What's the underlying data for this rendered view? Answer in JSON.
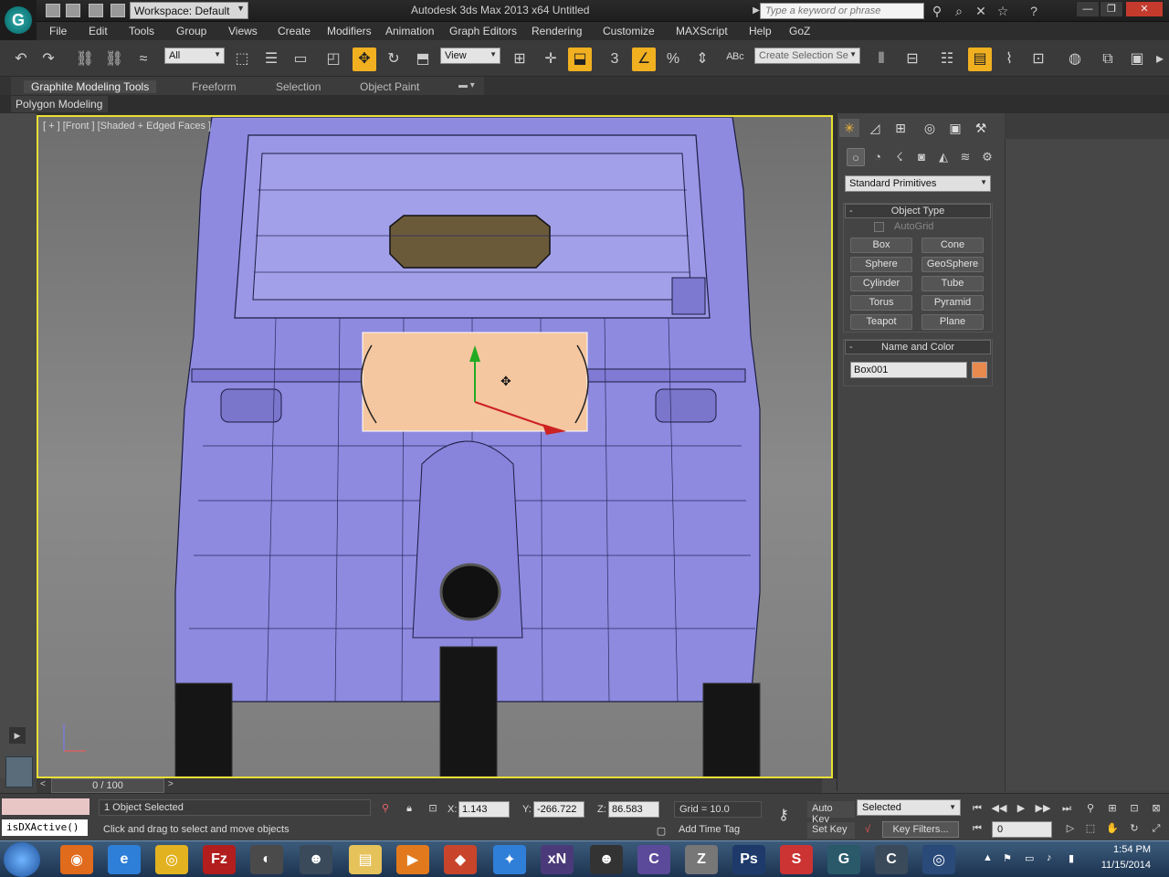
{
  "titlebar": {
    "workspace": "Workspace: Default",
    "title": "Autodesk 3ds Max  2013 x64      Untitled",
    "search_placeholder": "Type a keyword or phrase"
  },
  "menu": [
    "File",
    "Edit",
    "Tools",
    "Group",
    "Views",
    "Create",
    "Modifiers",
    "Animation",
    "Graph Editors",
    "Rendering",
    "Customize",
    "MAXScript",
    "Help",
    "GoZ"
  ],
  "toolbar": {
    "filter_value": "All",
    "ref_coord": "View",
    "selection_set_placeholder": "Create Selection Se"
  },
  "ribbon": {
    "tabs": [
      "Graphite Modeling Tools",
      "Freeform",
      "Selection",
      "Object Paint"
    ],
    "panel": "Polygon Modeling"
  },
  "viewport": {
    "label": "[ + ] [Front ] [Shaded + Edged Faces ]",
    "active_color": "#e9e035",
    "selected_object_color": "#f4c7a0"
  },
  "command_panel": {
    "primitive_type": "Standard Primitives",
    "object_type_title": "Object Type",
    "autogrid_label": "AutoGrid",
    "buttons": [
      "Box",
      "Cone",
      "Sphere",
      "GeoSphere",
      "Cylinder",
      "Tube",
      "Torus",
      "Pyramid",
      "Teapot",
      "Plane"
    ],
    "name_color_title": "Name and Color",
    "object_name": "Box001",
    "object_color": "#e8894d"
  },
  "timeline": {
    "frame": "0 / 100"
  },
  "status": {
    "selection": "1 Object Selected",
    "prompt": "Click and drag to select and move objects",
    "maxscript": "isDXActive()",
    "x_label": "X:",
    "x": "1.143",
    "y_label": "Y:",
    "y": "-266.722",
    "z_label": "Z:",
    "z": "86.583",
    "grid": "Grid = 10.0",
    "add_time_tag": "Add Time Tag",
    "auto_key": "Auto Key",
    "set_key": "Set Key",
    "key_mode": "Selected",
    "key_filters": "Key Filters...",
    "current_frame": "0"
  },
  "taskbar": {
    "time": "1:54 PM",
    "date": "11/15/2014"
  }
}
